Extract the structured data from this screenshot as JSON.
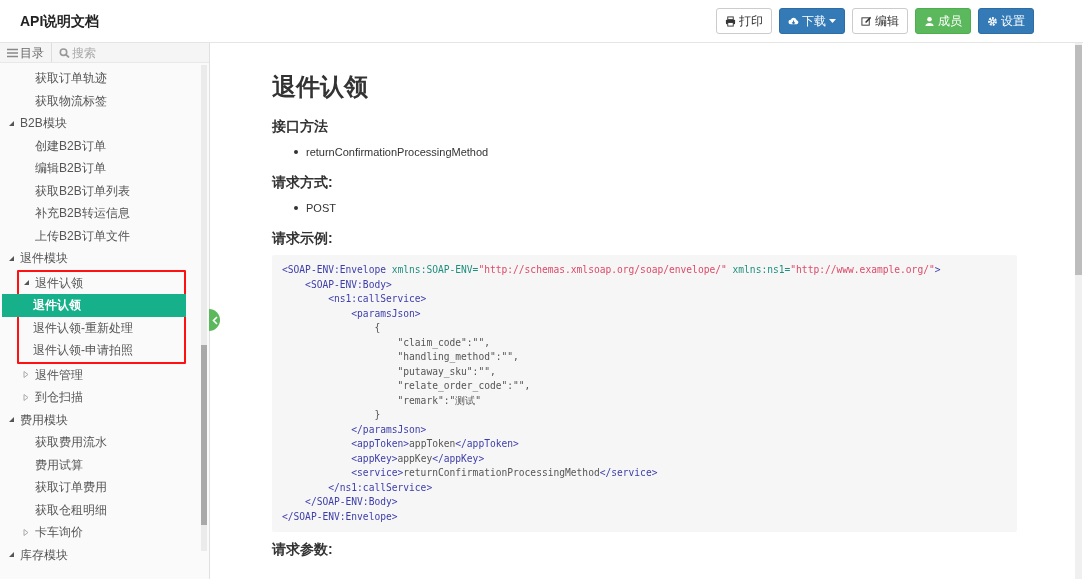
{
  "header": {
    "title": "API说明文档",
    "buttons": [
      {
        "label": "打印",
        "kind": "print",
        "caret": false
      },
      {
        "label": "下载",
        "kind": "download",
        "caret": true
      },
      {
        "label": "编辑",
        "kind": "edit",
        "caret": false
      },
      {
        "label": "成员",
        "kind": "members",
        "caret": false
      },
      {
        "label": "设置",
        "kind": "settings",
        "caret": false
      }
    ]
  },
  "sidebar": {
    "tabs": [
      {
        "label": "目录",
        "kind": "toc"
      },
      {
        "label": "搜索",
        "kind": "search"
      }
    ],
    "continued_items": [
      {
        "label": "获取订单轨迹"
      },
      {
        "label": "获取物流标签"
      }
    ],
    "items": [
      {
        "label": "B2B模块",
        "expanded": true,
        "children": [
          {
            "label": "创建B2B订单"
          },
          {
            "label": "编辑B2B订单"
          },
          {
            "label": "获取B2B订单列表"
          },
          {
            "label": "补充B2B转运信息"
          },
          {
            "label": "上传B2B订单文件"
          }
        ]
      },
      {
        "label": "退件模块",
        "expanded": true,
        "children": [
          {
            "label": "退件认领",
            "expanded": true,
            "highlighted": true,
            "children": [
              {
                "label": "退件认领",
                "selected": true
              },
              {
                "label": "退件认领-重新处理",
                "selected": false
              },
              {
                "label": "退件认领-申请拍照",
                "selected": false
              }
            ]
          },
          {
            "label": "退件管理",
            "expanded": false
          },
          {
            "label": "到仓扫描",
            "expanded": false
          }
        ]
      },
      {
        "label": "费用模块",
        "expanded": true,
        "children": [
          {
            "label": "获取费用流水"
          },
          {
            "label": "费用试算"
          },
          {
            "label": "获取订单费用"
          },
          {
            "label": "获取仓租明细"
          },
          {
            "label": "卡车询价",
            "expanded": false
          }
        ]
      },
      {
        "label": "库存模块",
        "expanded": true
      }
    ]
  },
  "content": {
    "title": "退件认领",
    "sections": [
      {
        "heading": "接口方法",
        "bullets": [
          "returnConfirmationProcessingMethod"
        ]
      },
      {
        "heading": "请求方式:",
        "bullets": [
          "POST"
        ]
      },
      {
        "heading": "请求示例:",
        "code": [
          [
            {
              "kind": "tag",
              "text": "<SOAP-ENV:Envelope "
            },
            {
              "kind": "attr",
              "text": "xmlns:SOAP-ENV="
            },
            {
              "kind": "string",
              "text": "\"http://schemas.xmlsoap.org/soap/envelope/\" "
            },
            {
              "kind": "attr",
              "text": "xmlns:ns1="
            },
            {
              "kind": "string",
              "text": "\"http://www.example.org/\""
            },
            {
              "kind": "tag",
              "text": ">"
            }
          ],
          [
            {
              "kind": "tag",
              "text": "    <SOAP-ENV:Body>"
            }
          ],
          [
            {
              "kind": "tag",
              "text": "        <ns1:callService>"
            }
          ],
          [
            {
              "kind": "tag",
              "text": "            <paramsJson>"
            }
          ],
          [
            {
              "kind": "plain",
              "text": "                {"
            }
          ],
          [
            {
              "kind": "plain",
              "text": "                    \"claim_code\":\"\","
            }
          ],
          [
            {
              "kind": "plain",
              "text": "                    \"handling_method\":\"\","
            }
          ],
          [
            {
              "kind": "plain",
              "text": "                    \"putaway_sku\":\"\","
            }
          ],
          [
            {
              "kind": "plain",
              "text": "                    \"relate_order_code\":\"\","
            }
          ],
          [
            {
              "kind": "plain",
              "text": "                    \"remark\":\"测试\""
            }
          ],
          [
            {
              "kind": "plain",
              "text": "                }"
            }
          ],
          [
            {
              "kind": "tag",
              "text": "            </paramsJson>"
            }
          ],
          [
            {
              "kind": "tag",
              "text": "            <appToken>"
            },
            {
              "kind": "plain",
              "text": "appToken"
            },
            {
              "kind": "tag",
              "text": "</appToken>"
            }
          ],
          [
            {
              "kind": "tag",
              "text": "            <appKey>"
            },
            {
              "kind": "plain",
              "text": "appKey"
            },
            {
              "kind": "tag",
              "text": "</appKey>"
            }
          ],
          [
            {
              "kind": "tag",
              "text": "            <service>"
            },
            {
              "kind": "plain",
              "text": "returnConfirmationProcessingMethod"
            },
            {
              "kind": "tag",
              "text": "</service>"
            }
          ],
          [
            {
              "kind": "tag",
              "text": "        </ns1:callService>"
            }
          ],
          [
            {
              "kind": "tag",
              "text": "    </SOAP-ENV:Body>"
            }
          ],
          [
            {
              "kind": "tag",
              "text": "</SOAP-ENV:Envelope>"
            }
          ]
        ]
      },
      {
        "heading": "请求参数:"
      }
    ]
  }
}
